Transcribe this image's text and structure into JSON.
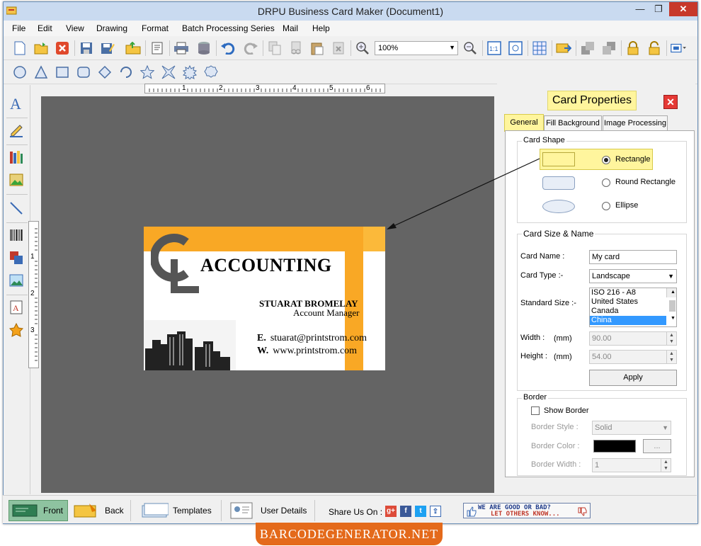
{
  "window": {
    "title": "DRPU Business Card Maker (Document1)",
    "min": "—",
    "max": "❐",
    "close": "✕"
  },
  "menu": [
    "File",
    "Edit",
    "View",
    "Drawing",
    "Format",
    "Batch Processing Series",
    "Mail",
    "Help"
  ],
  "toolbar": {
    "zoom": "100%"
  },
  "ruler": {
    "h_labels": [
      "1",
      "2",
      "3",
      "4",
      "5",
      "6"
    ],
    "v_labels": [
      "1",
      "2",
      "3"
    ]
  },
  "card": {
    "logo_letters": "GL",
    "company": "ACCOUNTING",
    "person": "STUARAT BROMELAY",
    "role": "Account Manager",
    "email_label": "E.",
    "email": "stuarat@printstrom.com",
    "web_label": "W.",
    "web": "www.printstrom.com"
  },
  "panel": {
    "title": "Card Properties",
    "tabs": [
      "General",
      "Fill Background",
      "Image Processing"
    ],
    "card_shape": {
      "title": "Card Shape",
      "options": [
        "Rectangle",
        "Round Rectangle",
        "Ellipse"
      ],
      "selected": "Rectangle"
    },
    "card_size": {
      "title": "Card Size & Name",
      "card_name_label": "Card Name :",
      "card_name": "My card",
      "card_type_label": "Card Type :-",
      "card_type": "Landscape",
      "standard_size_label": "Standard Size :-",
      "standard_sizes": [
        "ISO 216 - A8",
        "United States",
        "Canada",
        "China"
      ],
      "selected_size": "China",
      "width_label": "Width :",
      "width_unit": "(mm)",
      "width": "90.00",
      "height_label": "Height :",
      "height_unit": "(mm)",
      "height": "54.00",
      "apply": "Apply"
    },
    "border": {
      "title": "Border",
      "show_border": "Show Border",
      "style_label": "Border Style :",
      "style": "Solid",
      "color_label": "Border Color :",
      "color_value": "#000000",
      "color_btn": "...",
      "width_label": "Border Width :",
      "width": "1"
    }
  },
  "statusbar": {
    "front": "Front",
    "back": "Back",
    "templates": "Templates",
    "user_details": "User Details",
    "share_label": "Share Us On :",
    "feedback_line1": "WE ARE GOOD OR BAD?",
    "feedback_line2": "LET OTHERS KNOW..."
  },
  "watermark": "BARCODEGENERATOR.NET",
  "colors": {
    "card_orange": "#f9a825",
    "tab_active": "#fff59d",
    "canvas": "#646464",
    "banner": "#e46a1b"
  }
}
